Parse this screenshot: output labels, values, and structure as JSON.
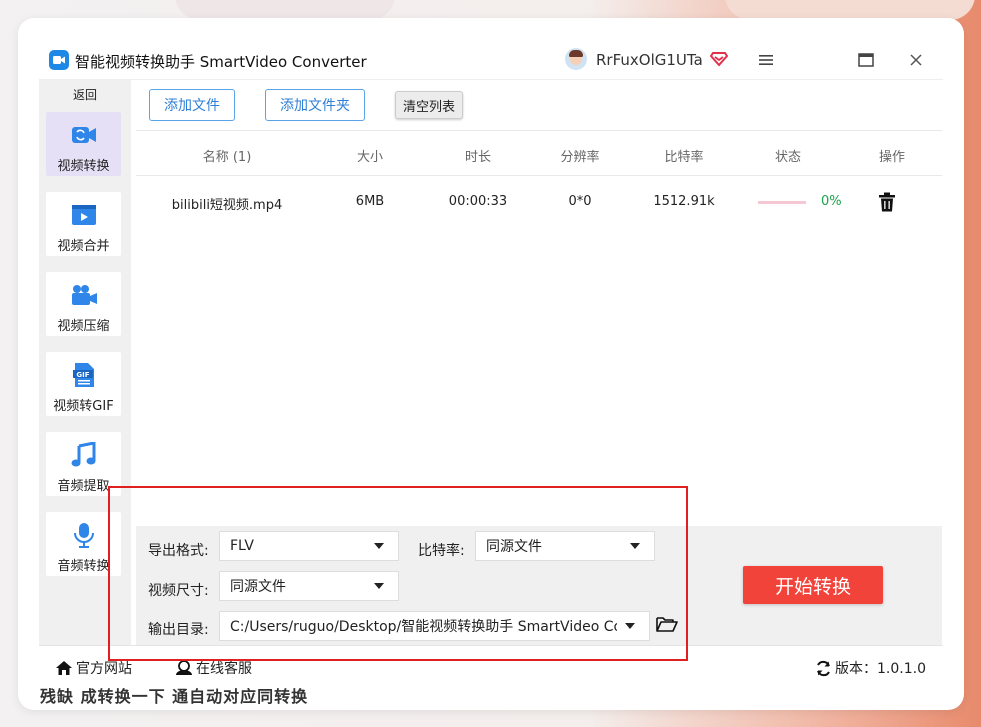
{
  "window": {
    "title": "智能视频转换助手 SmartVideo Converter",
    "username": "RrFuxOlG1UTa",
    "logo_icon": "video-convert-logo",
    "controls": [
      "menu-icon",
      "maximize-icon",
      "close-icon"
    ]
  },
  "sidebar": {
    "back_label": "返回",
    "items": [
      {
        "label": "视频转换",
        "icon": "video-convert-icon",
        "active": true
      },
      {
        "label": "视频合并",
        "icon": "video-merge-icon",
        "active": false
      },
      {
        "label": "视频压缩",
        "icon": "video-camera-icon",
        "active": false
      },
      {
        "label": "视频转GIF",
        "icon": "gif-file-icon",
        "active": false
      },
      {
        "label": "音频提取",
        "icon": "music-note-icon",
        "active": false
      },
      {
        "label": "音频转换",
        "icon": "microphone-icon",
        "active": false
      }
    ]
  },
  "toolbar": {
    "add_file": "添加文件",
    "add_folder": "添加文件夹",
    "clear_list": "清空列表"
  },
  "table": {
    "headers": [
      "名称 (1)",
      "大小",
      "时长",
      "分辨率",
      "比特率",
      "状态",
      "操作"
    ],
    "rows": [
      {
        "name": "bilibili短视频.mp4",
        "size": "6MB",
        "duration": "00:00:33",
        "resolution": "0*0",
        "bitrate": "1512.91k",
        "progress_percent": 0,
        "status": "0%"
      }
    ]
  },
  "settings": {
    "format_label": "导出格式:",
    "format_value": "FLV",
    "bitrate_label": "比特率:",
    "bitrate_value": "同源文件",
    "size_label": "视频尺寸:",
    "size_value": "同源文件",
    "output_label": "输出目录:",
    "output_value": "C:/Users/ruguo/Desktop/智能视频转换助手 SmartVideo Converter",
    "start_button": "开始转换"
  },
  "footer": {
    "website": "官方网站",
    "support": "在线客服",
    "version": "版本：1.0.1.0"
  },
  "background_text": "残缺  成转换一下  通自动对应同转换",
  "colors": {
    "accent_blue": "#2f7fd6",
    "start_red": "#f2433b",
    "progress_green": "#1aa34a",
    "annotation_red": "#e02020"
  }
}
